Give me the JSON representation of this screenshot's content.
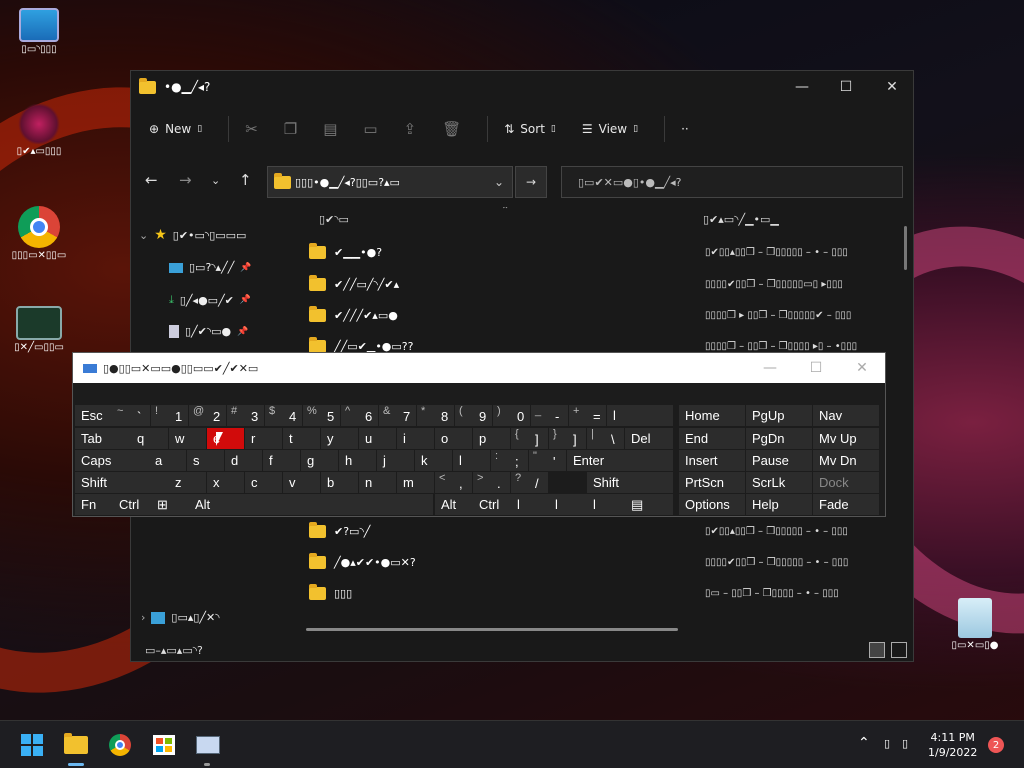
{
  "desktop": {
    "icons": [
      {
        "name": "desktop-icon-this-pc",
        "label": "▯▭◝▯▯▯",
        "icon": "monitor-icon"
      },
      {
        "name": "desktop-icon-app",
        "label": "▯✔▴▭▯▯▯",
        "icon": "app-icon"
      },
      {
        "name": "desktop-icon-chrome",
        "label": "▯▯▯▭✕▯▯▭",
        "icon": "chrome-icon"
      },
      {
        "name": "desktop-icon-monitor",
        "label": "▯✕╱▭▯▯▭",
        "icon": "activity-monitor-icon"
      },
      {
        "name": "desktop-icon-recycle-bin",
        "label": "▯▭✕▭▯●",
        "icon": "recycle-bin-icon"
      }
    ]
  },
  "explorer": {
    "title": "•●▁╱◂?",
    "toolbar": {
      "new_label": "New",
      "sort_label": "Sort",
      "view_label": "View",
      "more_label": "··"
    },
    "address_text": "▯▯▯•●▁╱◂?▯▯▭?▴▭",
    "search_placeholder": "▯▭✔✕▭●▯•●▁╱◂?",
    "nav": [
      {
        "label": "▯✔•▭◝▯▭▭▭",
        "icon": "star-icon"
      },
      {
        "label": "▯▭?◝▴╱╱",
        "icon": "desktop-icon"
      },
      {
        "label": "▯╱◂●▭╱✔",
        "icon": "download-icon"
      },
      {
        "label": "▯╱✔◝▭●",
        "icon": "document-icon"
      },
      {
        "label": "▯▭▴▯╱✕◝",
        "icon": "network-icon"
      }
    ],
    "columns": {
      "name": "▯✔◝▭",
      "date": "▯✔▴▭◝╱▁•▭▁"
    },
    "files": [
      {
        "name": "✔▁▁•●?",
        "date": "▯✔▯▯▴▯▯❒ – ❒▯▯▯▯▯ – • – ▯▯▯"
      },
      {
        "name": "✔╱╱▭╱◝╱✔▴",
        "date": "▯▯▯▯✔▯▯❒ – ❒▯▯▯▯▯▭▯ ▸▯▯▯"
      },
      {
        "name": "✔╱╱╱✔▴▭●",
        "date": "▯▯▯▯❒ ▸ ▯▯❒ – ❒▯▯▯▯▯✔ – ▯▯▯"
      },
      {
        "name": "╱╱▭✔▁•●▭??",
        "date": "▯▯▯▯❒ – ▯▯❒ – ❒▯▯▯▯ ▸▯ – •▯▯▯"
      },
      {
        "name": "✔?▭◝╱",
        "date": "▯✔▯▯▴▯▯❒ – ❒▯▯▯▯▯ – • – ▯▯▯"
      },
      {
        "name": "╱●▴✔✔•●▭✕?",
        "date": "▯▯▯▯✔▯▯❒ – ❒▯▯▯▯▯ – • – ▯▯▯"
      },
      {
        "name": "▯▯▯",
        "date": "▯▭ – ▯▯❒ – ❒▯▯▯▯ – • – ▯▯▯"
      }
    ],
    "status_text": "▭–▴▭▴▭◝?"
  },
  "osk": {
    "title": "▯●▯▯▭✕▭▭●▯▯▭▭✔╱✔✕▭",
    "rows": [
      [
        {
          "s": "~",
          "m": "`"
        },
        {
          "s": "!",
          "m": "1"
        },
        {
          "s": "@",
          "m": "2"
        },
        {
          "s": "#",
          "m": "3"
        },
        {
          "s": "$",
          "m": "4"
        },
        {
          "s": "%",
          "m": "5"
        },
        {
          "s": "^",
          "m": "6"
        },
        {
          "s": "&",
          "m": "7"
        },
        {
          "s": "*",
          "m": "8"
        },
        {
          "s": "(",
          "m": "9"
        },
        {
          "s": ")",
          "m": "0"
        },
        {
          "s": "_",
          "m": "-"
        },
        {
          "s": "+",
          "m": "="
        }
      ],
      [
        "q",
        "w",
        "e",
        "r",
        "t",
        "y",
        "u",
        "i",
        "o",
        "p"
      ],
      [
        "a",
        "s",
        "d",
        "f",
        "g",
        "h",
        "j",
        "k",
        "l"
      ],
      [
        "z",
        "x",
        "c",
        "v",
        "b",
        "n",
        "m"
      ]
    ],
    "special": {
      "esc": "Esc",
      "tab": "Tab",
      "caps": "Caps",
      "shift": "Shift",
      "fn": "Fn",
      "ctrl": "Ctrl",
      "alt": "Alt",
      "del": "Del",
      "enter": "Enter",
      "backspace": "l"
    },
    "nav_keys": [
      [
        "Home",
        "PgUp",
        "Nav"
      ],
      [
        "End",
        "PgDn",
        "Mv Up"
      ],
      [
        "Insert",
        "Pause",
        "Mv Dn"
      ],
      [
        "PrtScn",
        "ScrLk",
        "Dock"
      ],
      [
        "Options",
        "Help",
        "Fade"
      ]
    ],
    "pressed_key": "e"
  },
  "taskbar": {
    "time": "4:11 PM",
    "date": "1/9/2022",
    "notification_count": "2"
  }
}
